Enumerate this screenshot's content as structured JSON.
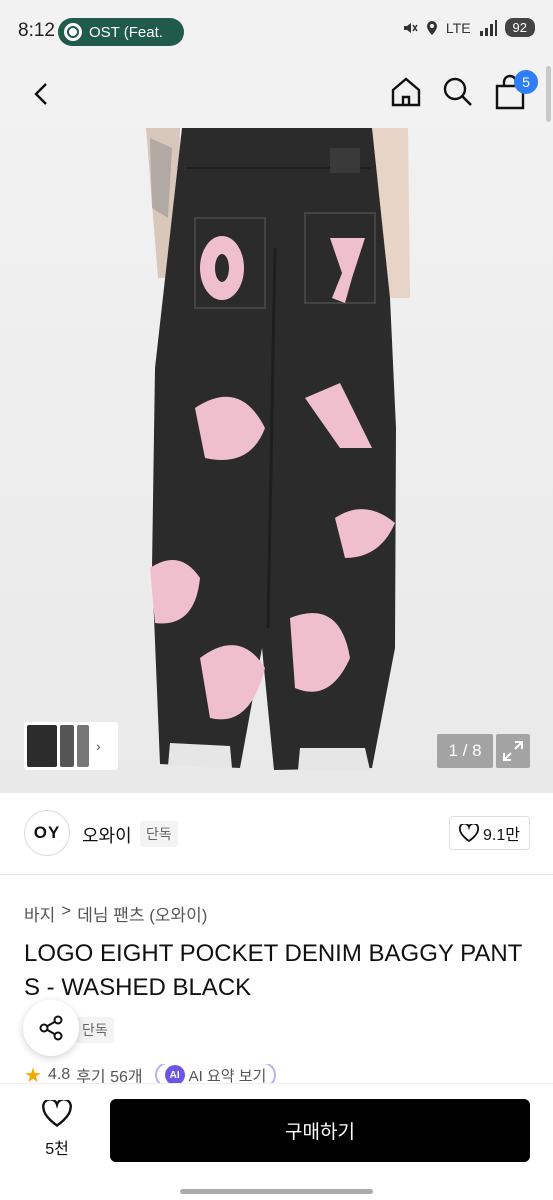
{
  "status_bar": {
    "time": "8:12",
    "media_title": "OST (Feat. ",
    "network": "LTE",
    "battery": "92"
  },
  "header": {
    "cart_count": "5"
  },
  "gallery": {
    "counter": "1 / 8",
    "thumb_next_glyph": "›"
  },
  "brand": {
    "logo_text": "OY",
    "name": "오와이",
    "tag": "단독",
    "likes": "9.1만"
  },
  "breadcrumb": {
    "category": "바지",
    "separator": ">",
    "subcategory": "데님 팬츠 (오와이)"
  },
  "product": {
    "title": "LOGO EIGHT POCKET DENIM BAGGY PANTS - WASHED BLACK",
    "badge": "단독"
  },
  "reviews": {
    "rating": "4.8",
    "review_label": "후기 56개",
    "ai_icon_text": "AI",
    "ai_summary": "AI 요약 보기"
  },
  "bottom": {
    "wish_count": "5천",
    "buy_label": "구매하기"
  },
  "colors": {
    "accent_badge": "#2d7ef7",
    "media_pill": "#1f5a4a",
    "jeans": "#2b2b2b",
    "patch_pink": "#efbfce",
    "buy_button": "#000000",
    "ai_purple": "#6a57e8"
  }
}
